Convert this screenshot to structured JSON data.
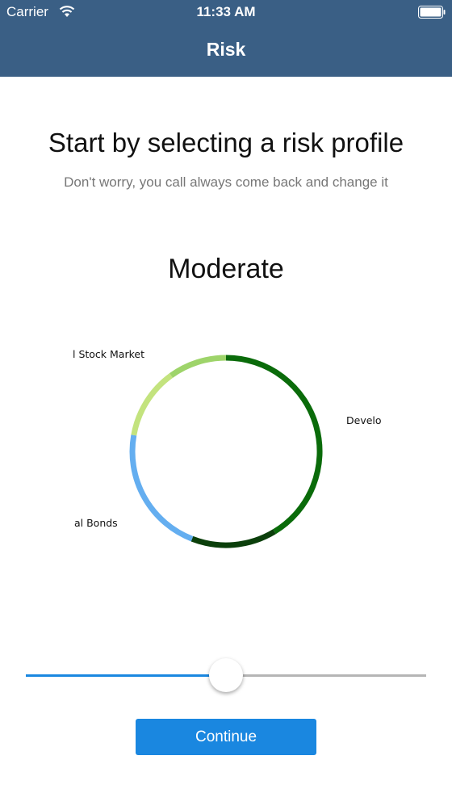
{
  "status_bar": {
    "carrier": "Carrier",
    "time": "11:33 AM"
  },
  "nav": {
    "title": "Risk"
  },
  "intro": {
    "headline": "Start by selecting a risk profile",
    "subline": "Don't worry, you call always come back and change it"
  },
  "profile": {
    "name": "Moderate"
  },
  "allocation_chart": {
    "type": "pie",
    "labels": [
      {
        "text": "l Stock Market",
        "color": "#9ed46a"
      },
      {
        "text": "Develo",
        "color": "#0a6b0a"
      },
      {
        "text": "al Bonds",
        "color": "#64aef0"
      }
    ],
    "colors": {
      "light_green": "#9ed46a",
      "pale_green": "#c3e37e",
      "light_blue": "#64aef0",
      "dark_green": "#0b3f0b",
      "forest_green": "#0a6b0a"
    }
  },
  "slider": {
    "value_fraction": 0.5
  },
  "actions": {
    "continue_label": "Continue"
  },
  "colors": {
    "header_bg": "#3a5f85",
    "accent": "#1a87e0"
  }
}
